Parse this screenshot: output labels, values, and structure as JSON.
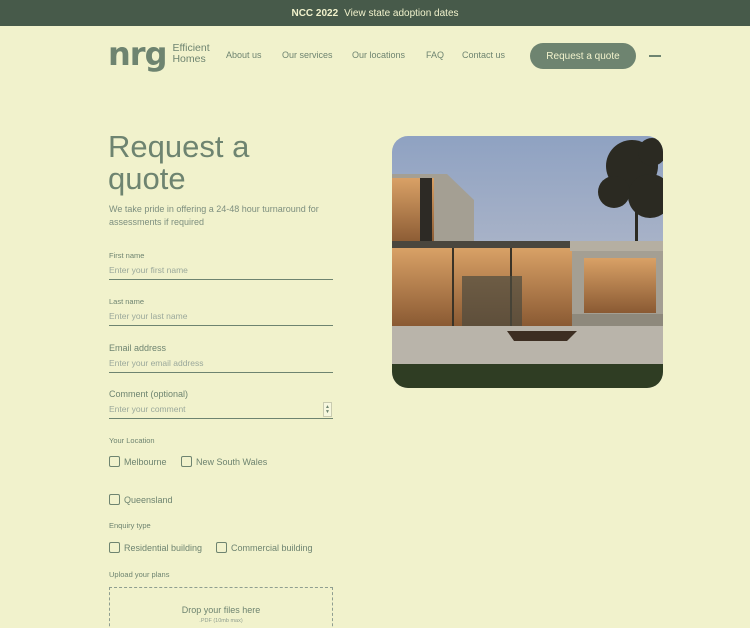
{
  "topbar": {
    "strong": "NCC 2022",
    "link": "View state adoption dates"
  },
  "logo": {
    "mark": "nrg",
    "line1": "Efficient",
    "line2": "Homes"
  },
  "nav": {
    "items": [
      {
        "label": "About us"
      },
      {
        "label": "Our services"
      },
      {
        "label": "Our locations"
      },
      {
        "label": "FAQ"
      },
      {
        "label": "Contact us"
      }
    ]
  },
  "cta": {
    "label": "Request a quote"
  },
  "hero": {
    "title_line1": "Request a",
    "title_line2": "quote",
    "subtitle": "We take pride in offering a 24-48 hour turnaround for assessments if required"
  },
  "form": {
    "first_name": {
      "label": "First name",
      "placeholder": "Enter your first name"
    },
    "last_name": {
      "label": "Last name",
      "placeholder": "Enter your last name"
    },
    "email": {
      "label": "Email address",
      "placeholder": "Enter your email address"
    },
    "comment": {
      "label": "Comment (optional)",
      "placeholder": "Enter your comment"
    },
    "location": {
      "label": "Your Location",
      "options": [
        {
          "label": "Melbourne",
          "checked": false
        },
        {
          "label": "New South Wales",
          "checked": false
        },
        {
          "label": "Queensland",
          "checked": false
        }
      ]
    },
    "enquiry": {
      "label": "Enquiry type",
      "options": [
        {
          "label": "Residential building",
          "checked": false
        },
        {
          "label": "Commercial building",
          "checked": false
        }
      ]
    },
    "upload": {
      "label": "Upload your plans",
      "drop_text": "Drop your files here",
      "hint": ".PDF (10mb max)"
    }
  },
  "colors": {
    "background": "#f1f2cc",
    "topbar": "#475a4a",
    "accent": "#6e8470"
  },
  "icons": {
    "menu": "hamburger-icon",
    "spinner": "resize-spinner-icon"
  }
}
